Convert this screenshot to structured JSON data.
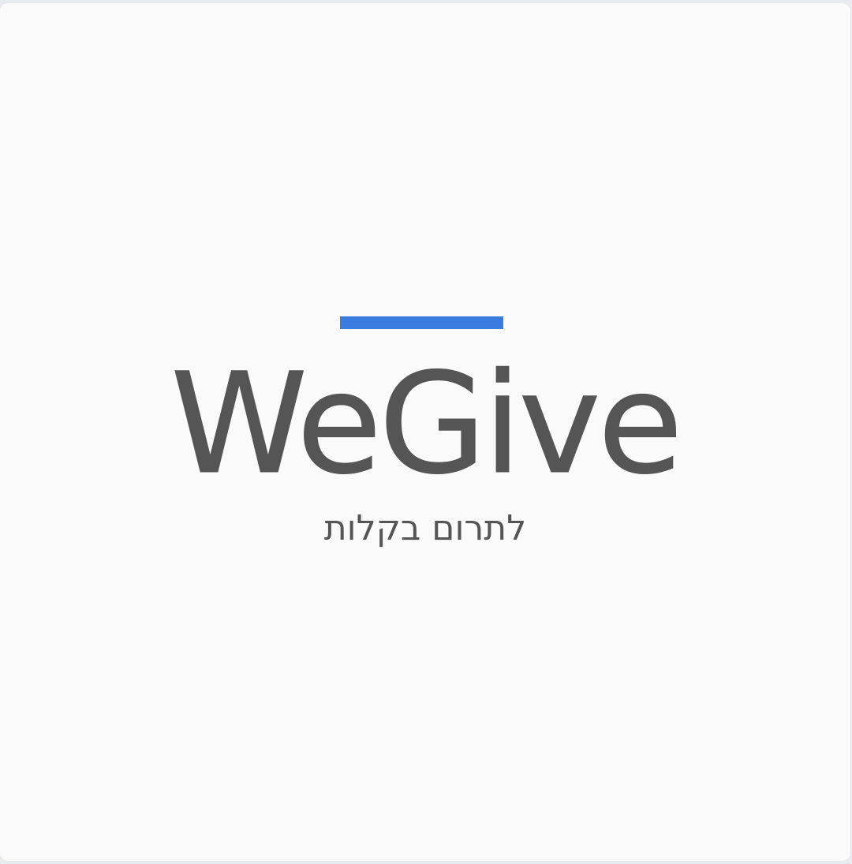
{
  "splash": {
    "logo_text": "WeGive",
    "tagline": "לתרום בקלות"
  },
  "colors": {
    "accent": "#3a7be0",
    "logo_text": "#555555",
    "tagline": "#555555",
    "background": "#fafafa"
  }
}
